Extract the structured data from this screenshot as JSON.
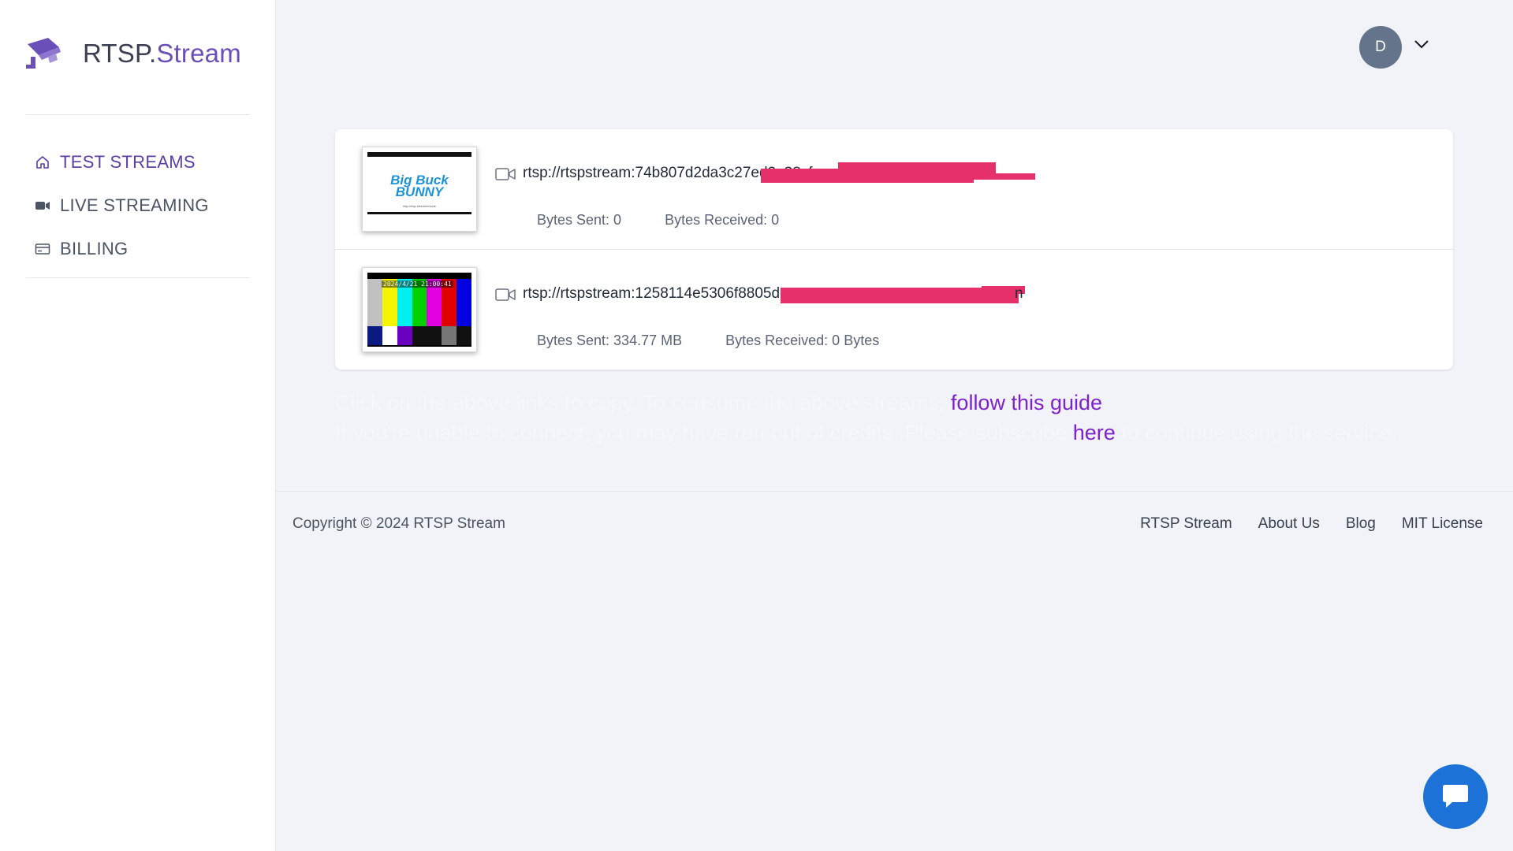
{
  "brand": {
    "name_main": "RTSP.",
    "name_accent": "Stream"
  },
  "sidebar": {
    "items": [
      {
        "label": "TEST STREAMS",
        "icon": "home-icon",
        "active": true
      },
      {
        "label": "LIVE STREAMING",
        "icon": "video-camera-icon",
        "active": false
      },
      {
        "label": "BILLING",
        "icon": "credit-card-icon",
        "active": false
      }
    ]
  },
  "header": {
    "avatar_initial": "D",
    "menu_icon": "chevron-down-icon"
  },
  "streams": [
    {
      "thumbnail": {
        "title_line1": "Big Buck",
        "title_line2": "BUNNY",
        "caption": "rtsp://rtsp.stream/movie"
      },
      "url": "rtsp://rtspstream:74b807d2da3c27ed2e38cfa",
      "bytes_sent": "Bytes Sent: 0",
      "bytes_received": "Bytes Received: 0"
    },
    {
      "thumbnail": {
        "timestamp": "2024/4/21 21:00:41"
      },
      "url": "rtsp://rtspstream:1258114e5306f8805dc",
      "url_tail": "n",
      "bytes_sent": "Bytes Sent: 334.77 MB",
      "bytes_received": "Bytes Received: 0 Bytes"
    }
  ],
  "info": {
    "line1_text": "Click on the above links to copy. To consume the above streams,",
    "line1_link": "follow this guide",
    "line2_text": "If you're unable to connect, you may have run out of credits. Please subscribe",
    "line2_link": "here",
    "line2_tail": "to continue using the service."
  },
  "footer": {
    "copyright": "Copyright © 2024 RTSP Stream",
    "links": [
      "RTSP Stream",
      "About Us",
      "Blog",
      "MIT License"
    ]
  },
  "colors": {
    "accent": "#6b4fb8",
    "link": "#7e22ce",
    "chat": "#1d72d8",
    "redaction": "#e5306a"
  }
}
